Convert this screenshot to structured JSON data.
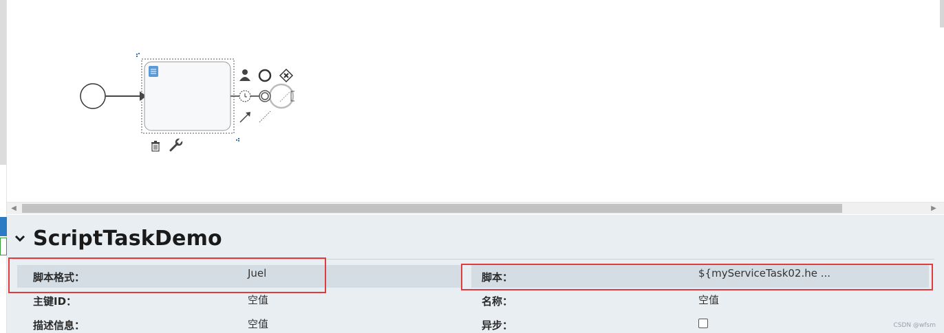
{
  "diagram": {
    "palette_icons": [
      "user-task-icon",
      "end-event-icon",
      "gateway-icon",
      "intermediate-event-icon",
      "boundary-event-icon",
      "text-annotation-icon",
      "sequence-flow-icon",
      "association-icon"
    ],
    "context_icons": [
      "delete-icon",
      "settings-wrench-icon"
    ],
    "task_icon": "script-task-icon"
  },
  "properties": {
    "title": "ScriptTaskDemo",
    "fields": {
      "script_format_label": "脚本格式：",
      "script_format_value": "Juel",
      "script_label": "脚本：",
      "script_value": "${myServiceTask02.he ...",
      "id_label": "主键ID：",
      "id_value": "空值",
      "name_label": "名称：",
      "name_value": "空值",
      "description_label": "描述信息：",
      "description_value": "空值",
      "async_label": "异步：",
      "async_checked": false
    }
  },
  "watermark": "CSDN @wfsm",
  "colors": {
    "highlight": "#e03b3b",
    "panel_bg": "#e8eef2",
    "accent_blue": "#5b9bd5"
  }
}
